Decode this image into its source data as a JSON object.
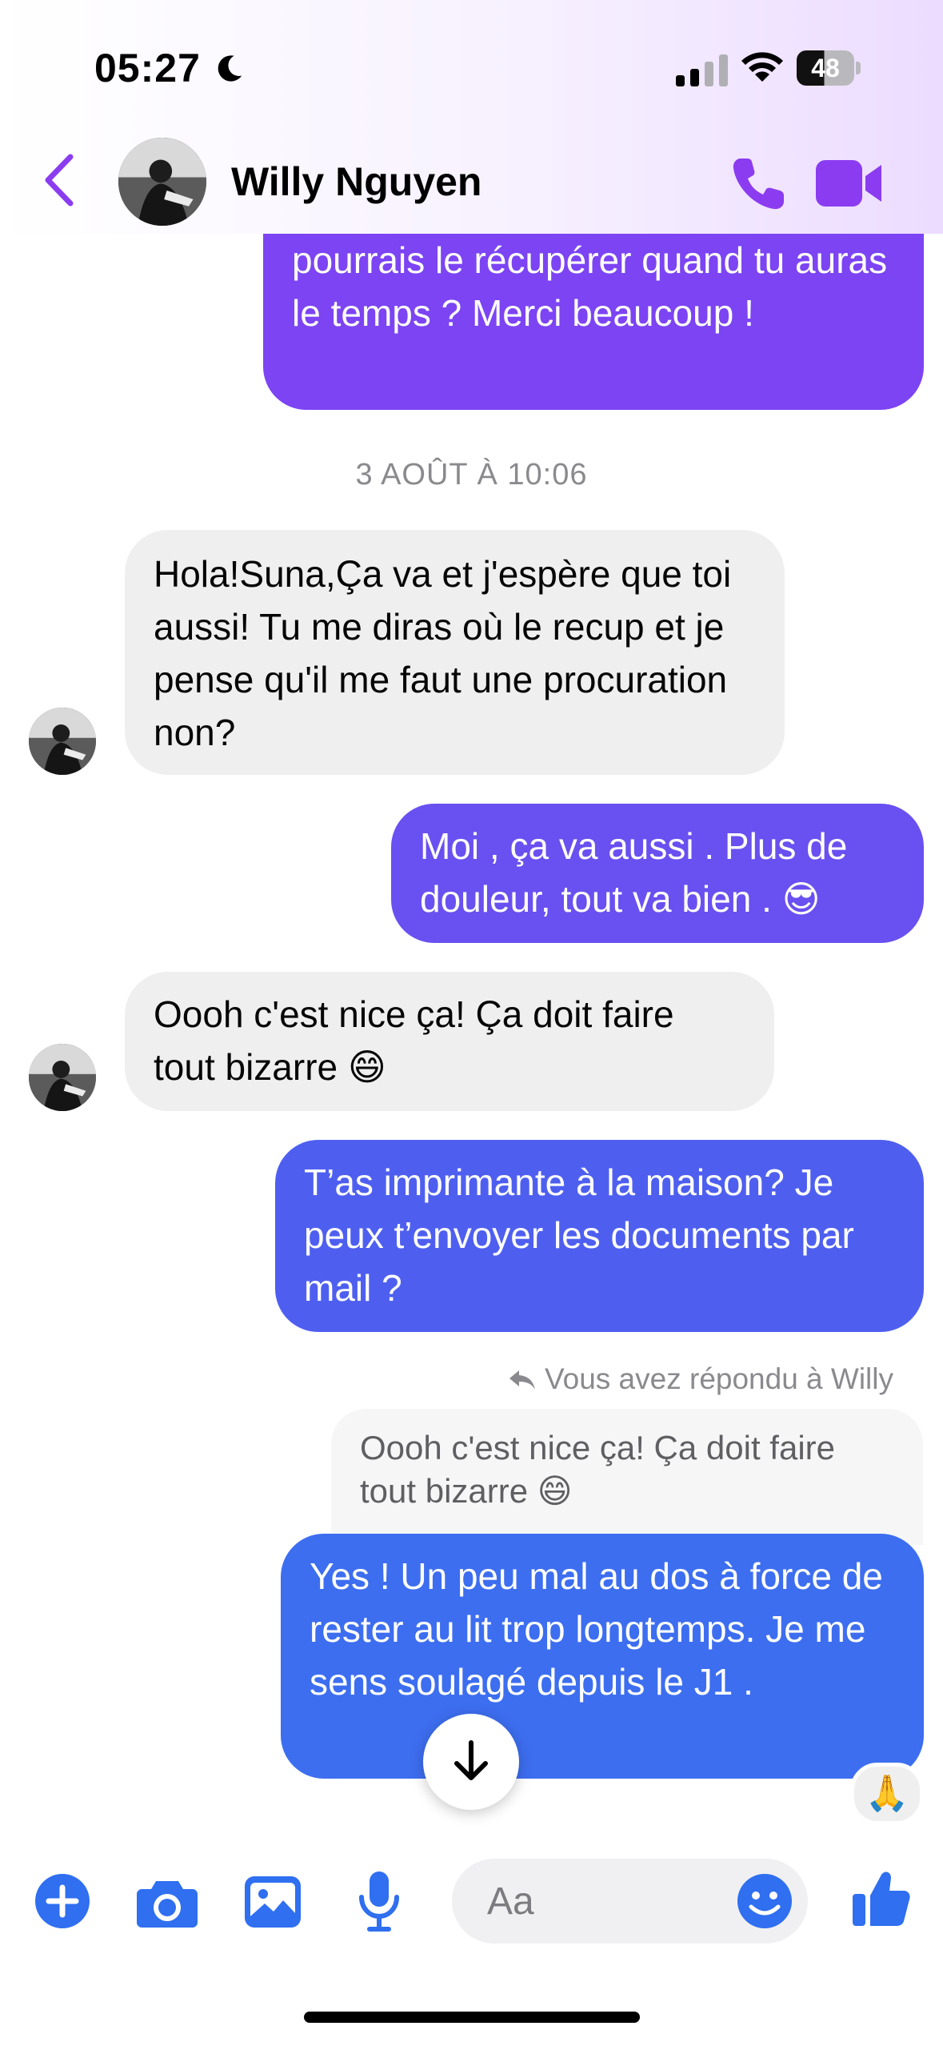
{
  "status_bar": {
    "time": "05:27",
    "battery": "48"
  },
  "header": {
    "contact_name": "Willy Nguyen"
  },
  "messages": [
    {
      "id": "m0",
      "direction": "outgoing",
      "text": "pourrais le récupérer quand tu auras le temps ? Merci beaucoup !"
    },
    {
      "id": "m1",
      "direction": "incoming",
      "text": "Hola!Suna,Ça va et j'espère que toi aussi! Tu me diras où le recup et je pense qu'il me faut une procuration non?"
    },
    {
      "id": "m2",
      "direction": "outgoing",
      "text": "Moi , ça va aussi . Plus de douleur, tout va bien . 😎"
    },
    {
      "id": "m3",
      "direction": "incoming",
      "text": "Oooh c'est nice ça! Ça doit faire tout bizarre 😄"
    },
    {
      "id": "m4",
      "direction": "outgoing",
      "text": "T’as imprimante à la maison? Je peux t’envoyer les documents par mail ?"
    },
    {
      "id": "m5",
      "direction": "outgoing",
      "text": "Yes ! Un peu mal au dos à force de rester au lit trop longtemps. Je me sens soulagé depuis le J1 ."
    }
  ],
  "date_separator": "3 AOÛT À 10:06",
  "reply": {
    "note": "Vous avez répondu à Willy",
    "quoted_text": "Oooh c'est nice ça! Ça doit faire tout bizarre 😄"
  },
  "reaction": "🙏",
  "composer": {
    "placeholder": "Aa"
  },
  "colors": {
    "accent_purple": "#8b3cf0",
    "bubble_purple": "#7a45f2",
    "bubble_indigo": "#5a55ee",
    "bubble_blue": "#3d6ff0",
    "incoming_bubble": "#efeff0",
    "composer_blue": "#2f6ff0"
  },
  "icons": [
    "moon-icon",
    "signal-icon",
    "wifi-icon",
    "battery-icon",
    "back-chevron-icon",
    "phone-icon",
    "video-camera-icon",
    "reply-arrow-icon",
    "arrow-down-icon",
    "plus-icon",
    "camera-icon",
    "gallery-icon",
    "microphone-icon",
    "emoji-icon",
    "thumbs-up-icon"
  ]
}
